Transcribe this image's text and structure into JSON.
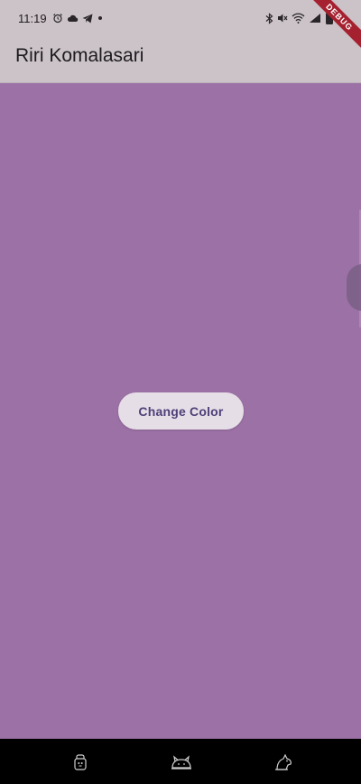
{
  "status_bar": {
    "time": "11:19",
    "left_icons": [
      "alarm-icon",
      "cloud-icon",
      "telegram-icon",
      "dot-icon"
    ],
    "right_icons": [
      "bluetooth-icon",
      "mute-icon",
      "wifi-icon",
      "signal-icon",
      "battery-icon"
    ]
  },
  "debug_banner": {
    "label": "DEBUG",
    "color": "#A6212F"
  },
  "app_bar": {
    "title": "Riri Komalasari",
    "background": "#CBC3C8"
  },
  "body": {
    "background": "#9C71A6",
    "change_color_button": {
      "label": "Change Color",
      "background": "#E6DEE6",
      "text_color": "#4E3F78"
    }
  },
  "nav_bar": {
    "buttons": [
      "recent-apps-icon",
      "home-cat-icon",
      "back-icon"
    ]
  }
}
